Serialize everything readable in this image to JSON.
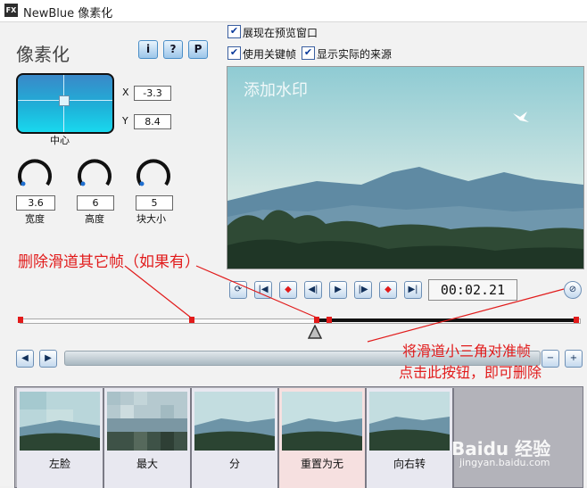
{
  "window": {
    "app_icon": "FX",
    "title": "NewBlue 像素化"
  },
  "effect": {
    "title": "像素化",
    "help_buttons": [
      "i",
      "?",
      "P"
    ]
  },
  "center": {
    "label": "中心",
    "x_label": "X",
    "x_value": "-3.3",
    "y_label": "Y",
    "y_value": "8.4"
  },
  "knobs": [
    {
      "value": "3.6",
      "label": "宽度"
    },
    {
      "value": "6",
      "label": "高度"
    },
    {
      "value": "5",
      "label": "块大小"
    }
  ],
  "options": {
    "show_in_preview": "展现在预览窗口",
    "use_keyframes": "使用关键帧",
    "show_actual_source": "显示实际的来源"
  },
  "preview": {
    "watermark": "添加水印"
  },
  "transport": {
    "icons": [
      "loop-icon",
      "go-start-icon",
      "prev-keyframe-icon",
      "step-back-icon",
      "play-icon",
      "step-forward-icon",
      "next-keyframe-icon",
      "go-end-icon"
    ],
    "timecode": "00:02.21",
    "delete_icon": "no-entry-icon"
  },
  "annotations": {
    "left": "删除滑道其它帧（如果有）",
    "right_line1": "将滑道小三角对准帧",
    "right_line2": "点击此按钮，即可删除"
  },
  "presets": [
    {
      "label": "左脸"
    },
    {
      "label": "最大"
    },
    {
      "label": "分"
    },
    {
      "label": "重置为无"
    },
    {
      "label": "向右转"
    }
  ],
  "zoom": {
    "minus": "−",
    "plus": "+"
  },
  "brand_watermark": {
    "line1": "Baidu 经验",
    "line2": "jingyan.baidu.com"
  },
  "colors": {
    "accent_blue": "#1fb0d8",
    "annotation_red": "#e11b1b",
    "keyframe_red": "#e21a1a"
  }
}
